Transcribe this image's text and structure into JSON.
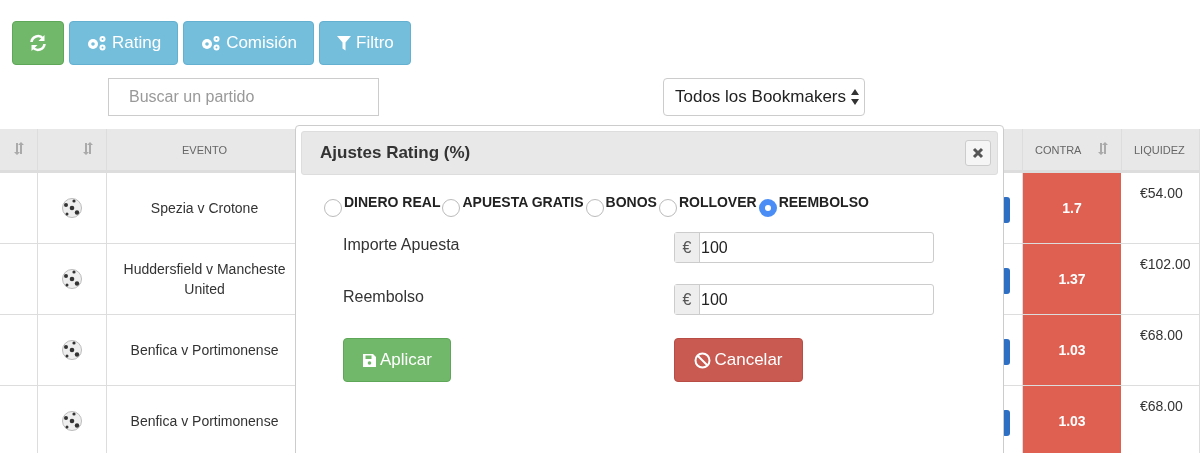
{
  "toolbar": [
    {
      "kind": "refresh"
    },
    {
      "kind": "gears",
      "label": "Rating"
    },
    {
      "kind": "gears",
      "label": "Comisión"
    },
    {
      "kind": "filter",
      "label": "Filtro"
    }
  ],
  "search": {
    "placeholder": "Buscar un partido"
  },
  "bookmaker_select": {
    "value": "Todos los Bookmakers"
  },
  "table": {
    "columns": [
      {
        "sortable": true
      },
      {
        "sortable": true
      },
      {
        "label": "EVENTO",
        "sortable": false
      },
      {
        "label": "CONTRA",
        "sortable": true
      },
      {
        "label": "LIQUIDEZ",
        "sortable": false
      }
    ],
    "rows": [
      {
        "event": "Spezia v Crotone",
        "contra": "1.7",
        "liquidez": "€54.00"
      },
      {
        "event": "Huddersfield v Mancheste United",
        "contra": "1.37",
        "liquidez": "€102.00"
      },
      {
        "event": "Benfica v Portimonense",
        "contra": "1.03",
        "liquidez": "€68.00"
      },
      {
        "event": "Benfica v Portimonense",
        "contra": "1.03",
        "liquidez": "€68.00"
      }
    ]
  },
  "modal": {
    "title": "Ajustes Rating (%)",
    "options": [
      {
        "label": "DINERO REAL",
        "selected": false
      },
      {
        "label": "APUESTA GRATIS",
        "selected": false
      },
      {
        "label": "BONOS",
        "selected": false
      },
      {
        "label": "ROLLOVER",
        "selected": false
      },
      {
        "label": "REEMBOLSO",
        "selected": true
      }
    ],
    "fields": [
      {
        "label": "Importe Apuesta",
        "addon": "€",
        "value": "100"
      },
      {
        "label": "Reembolso",
        "addon": "€",
        "value": "100"
      }
    ],
    "buttons": [
      {
        "kind": "apply",
        "label": "Aplicar"
      },
      {
        "kind": "cancel",
        "label": "Cancelar"
      }
    ]
  }
}
